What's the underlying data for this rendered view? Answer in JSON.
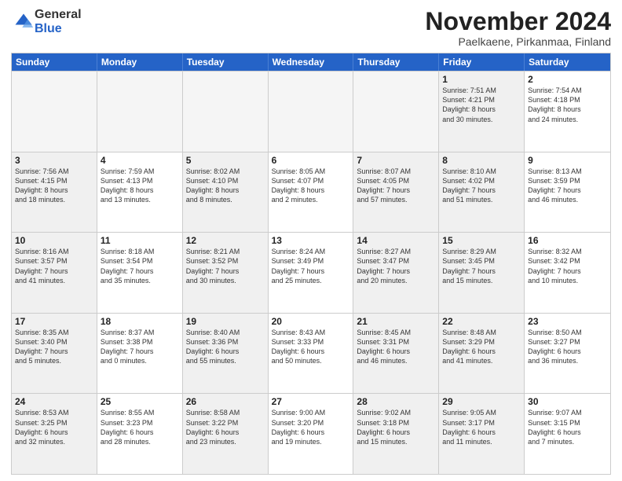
{
  "logo": {
    "general": "General",
    "blue": "Blue"
  },
  "title": "November 2024",
  "location": "Paelkaene, Pirkanmaa, Finland",
  "header_days": [
    "Sunday",
    "Monday",
    "Tuesday",
    "Wednesday",
    "Thursday",
    "Friday",
    "Saturday"
  ],
  "weeks": [
    [
      {
        "day": "",
        "info": "",
        "empty": true
      },
      {
        "day": "",
        "info": "",
        "empty": true
      },
      {
        "day": "",
        "info": "",
        "empty": true
      },
      {
        "day": "",
        "info": "",
        "empty": true
      },
      {
        "day": "",
        "info": "",
        "empty": true
      },
      {
        "day": "1",
        "info": "Sunrise: 7:51 AM\nSunset: 4:21 PM\nDaylight: 8 hours\nand 30 minutes.",
        "shaded": true
      },
      {
        "day": "2",
        "info": "Sunrise: 7:54 AM\nSunset: 4:18 PM\nDaylight: 8 hours\nand 24 minutes."
      }
    ],
    [
      {
        "day": "3",
        "info": "Sunrise: 7:56 AM\nSunset: 4:15 PM\nDaylight: 8 hours\nand 18 minutes.",
        "shaded": true
      },
      {
        "day": "4",
        "info": "Sunrise: 7:59 AM\nSunset: 4:13 PM\nDaylight: 8 hours\nand 13 minutes."
      },
      {
        "day": "5",
        "info": "Sunrise: 8:02 AM\nSunset: 4:10 PM\nDaylight: 8 hours\nand 8 minutes.",
        "shaded": true
      },
      {
        "day": "6",
        "info": "Sunrise: 8:05 AM\nSunset: 4:07 PM\nDaylight: 8 hours\nand 2 minutes."
      },
      {
        "day": "7",
        "info": "Sunrise: 8:07 AM\nSunset: 4:05 PM\nDaylight: 7 hours\nand 57 minutes.",
        "shaded": true
      },
      {
        "day": "8",
        "info": "Sunrise: 8:10 AM\nSunset: 4:02 PM\nDaylight: 7 hours\nand 51 minutes.",
        "shaded": true
      },
      {
        "day": "9",
        "info": "Sunrise: 8:13 AM\nSunset: 3:59 PM\nDaylight: 7 hours\nand 46 minutes."
      }
    ],
    [
      {
        "day": "10",
        "info": "Sunrise: 8:16 AM\nSunset: 3:57 PM\nDaylight: 7 hours\nand 41 minutes.",
        "shaded": true
      },
      {
        "day": "11",
        "info": "Sunrise: 8:18 AM\nSunset: 3:54 PM\nDaylight: 7 hours\nand 35 minutes."
      },
      {
        "day": "12",
        "info": "Sunrise: 8:21 AM\nSunset: 3:52 PM\nDaylight: 7 hours\nand 30 minutes.",
        "shaded": true
      },
      {
        "day": "13",
        "info": "Sunrise: 8:24 AM\nSunset: 3:49 PM\nDaylight: 7 hours\nand 25 minutes."
      },
      {
        "day": "14",
        "info": "Sunrise: 8:27 AM\nSunset: 3:47 PM\nDaylight: 7 hours\nand 20 minutes.",
        "shaded": true
      },
      {
        "day": "15",
        "info": "Sunrise: 8:29 AM\nSunset: 3:45 PM\nDaylight: 7 hours\nand 15 minutes.",
        "shaded": true
      },
      {
        "day": "16",
        "info": "Sunrise: 8:32 AM\nSunset: 3:42 PM\nDaylight: 7 hours\nand 10 minutes."
      }
    ],
    [
      {
        "day": "17",
        "info": "Sunrise: 8:35 AM\nSunset: 3:40 PM\nDaylight: 7 hours\nand 5 minutes.",
        "shaded": true
      },
      {
        "day": "18",
        "info": "Sunrise: 8:37 AM\nSunset: 3:38 PM\nDaylight: 7 hours\nand 0 minutes."
      },
      {
        "day": "19",
        "info": "Sunrise: 8:40 AM\nSunset: 3:36 PM\nDaylight: 6 hours\nand 55 minutes.",
        "shaded": true
      },
      {
        "day": "20",
        "info": "Sunrise: 8:43 AM\nSunset: 3:33 PM\nDaylight: 6 hours\nand 50 minutes."
      },
      {
        "day": "21",
        "info": "Sunrise: 8:45 AM\nSunset: 3:31 PM\nDaylight: 6 hours\nand 46 minutes.",
        "shaded": true
      },
      {
        "day": "22",
        "info": "Sunrise: 8:48 AM\nSunset: 3:29 PM\nDaylight: 6 hours\nand 41 minutes.",
        "shaded": true
      },
      {
        "day": "23",
        "info": "Sunrise: 8:50 AM\nSunset: 3:27 PM\nDaylight: 6 hours\nand 36 minutes."
      }
    ],
    [
      {
        "day": "24",
        "info": "Sunrise: 8:53 AM\nSunset: 3:25 PM\nDaylight: 6 hours\nand 32 minutes.",
        "shaded": true
      },
      {
        "day": "25",
        "info": "Sunrise: 8:55 AM\nSunset: 3:23 PM\nDaylight: 6 hours\nand 28 minutes."
      },
      {
        "day": "26",
        "info": "Sunrise: 8:58 AM\nSunset: 3:22 PM\nDaylight: 6 hours\nand 23 minutes.",
        "shaded": true
      },
      {
        "day": "27",
        "info": "Sunrise: 9:00 AM\nSunset: 3:20 PM\nDaylight: 6 hours\nand 19 minutes."
      },
      {
        "day": "28",
        "info": "Sunrise: 9:02 AM\nSunset: 3:18 PM\nDaylight: 6 hours\nand 15 minutes.",
        "shaded": true
      },
      {
        "day": "29",
        "info": "Sunrise: 9:05 AM\nSunset: 3:17 PM\nDaylight: 6 hours\nand 11 minutes.",
        "shaded": true
      },
      {
        "day": "30",
        "info": "Sunrise: 9:07 AM\nSunset: 3:15 PM\nDaylight: 6 hours\nand 7 minutes."
      }
    ]
  ]
}
